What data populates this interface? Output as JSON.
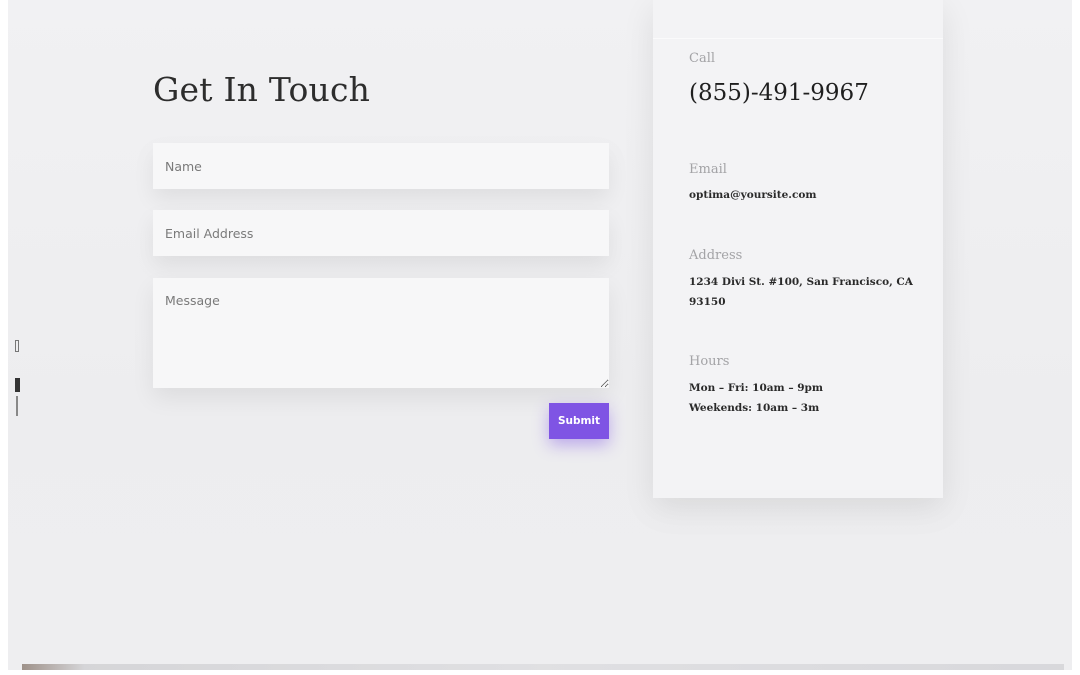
{
  "contact_form": {
    "heading": "Get In Touch",
    "name_placeholder": "Name",
    "email_placeholder": "Email Address",
    "message_placeholder": "Message",
    "submit_label": "Submit"
  },
  "contact_info": {
    "call_label": "Call",
    "phone": "(855)-491-9967",
    "email_label": "Email",
    "email": "optima@yoursite.com",
    "address_label": "Address",
    "address": "1234 Divi St. #100, San Francisco, CA 93150",
    "hours_label": "Hours",
    "hours_weekdays": "Mon – Fri: 10am – 9pm",
    "hours_weekends": "Weekends: 10am – 3m"
  },
  "colors": {
    "accent": "#7f54e4",
    "background": "#efeff1",
    "card": "#f3f3f5"
  }
}
